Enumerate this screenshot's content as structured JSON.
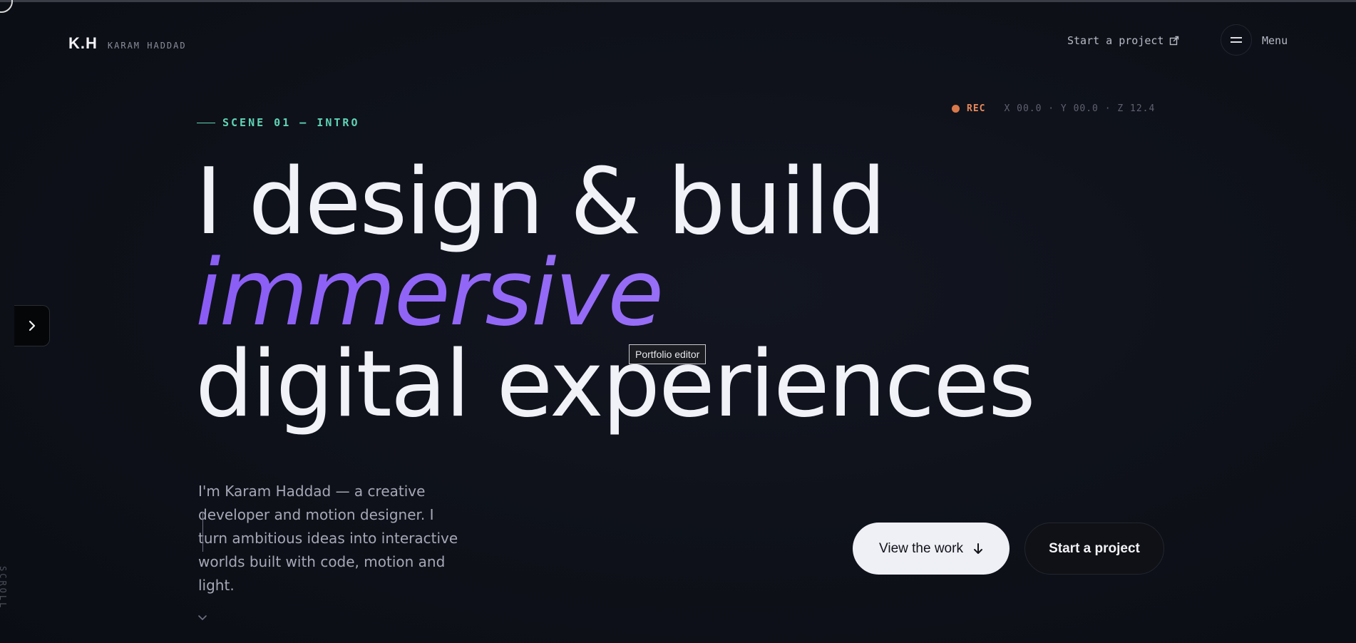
{
  "header": {
    "logo_mark": "K.H",
    "logo_name": "KARAM HADDAD",
    "start_project_link": "Start a project",
    "menu_label": "Menu"
  },
  "scene": {
    "label": "SCENE 01 — INTRO"
  },
  "hud": {
    "rec_label": "REC",
    "coords": "X 00.0 · Y 00.0 · Z 12.4"
  },
  "hero": {
    "line1": "I design & build",
    "line2": "immersive",
    "line3": "digital experiences",
    "intro": "I'm Karam Haddad — a creative developer and motion designer. I turn ambitious ideas into interactive worlds built with code, motion and light."
  },
  "tooltip": {
    "text": "Portfolio editor"
  },
  "scroll": {
    "label": "SCROLL"
  },
  "cta": {
    "primary": "View the work",
    "secondary": "Start a project"
  },
  "icons": {
    "external_link": "external-link-icon",
    "menu": "hamburger-icon",
    "arrow_down": "arrow-down-icon",
    "chevron_right": "chevron-right-icon",
    "chevron_down": "chevron-down-icon"
  },
  "colors": {
    "background": "#0e1119",
    "accent_purple": "#9b72f8",
    "accent_teal": "#5fd4b6",
    "rec_orange": "#e8895a"
  }
}
